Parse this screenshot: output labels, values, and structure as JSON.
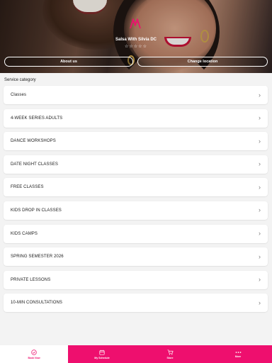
{
  "header": {
    "studio_name": "Salsa With Silvia DC",
    "rating_stars": "☆☆☆☆☆",
    "about_button": "About us",
    "location_button": "Change location",
    "accent_color": "#ee0f6e"
  },
  "section": {
    "label": "Service category"
  },
  "categories": [
    {
      "label": "Classes"
    },
    {
      "label": "4-WEEK SERIES ADULTS"
    },
    {
      "label": "DANCE WORKSHOPS"
    },
    {
      "label": "DATE NIGHT CLASSES"
    },
    {
      "label": "FREE CLASSES"
    },
    {
      "label": "KIDS DROP IN CLASSES"
    },
    {
      "label": "KIDS CAMPS"
    },
    {
      "label": "SPRING SEMESTER 2026"
    },
    {
      "label": "PRIVATE LESSONS"
    },
    {
      "label": "10-MIN CONSULTATIONS"
    }
  ],
  "chevron": "›",
  "tabbar": {
    "book_now": {
      "label": "Book Now",
      "icon": "check-circle-icon"
    },
    "my_schedule": {
      "label": "My Schedule",
      "icon": "calendar-icon"
    },
    "store": {
      "label": "Store",
      "icon": "cart-icon"
    },
    "more": {
      "label": "More",
      "icon": "more-dots-icon"
    }
  }
}
